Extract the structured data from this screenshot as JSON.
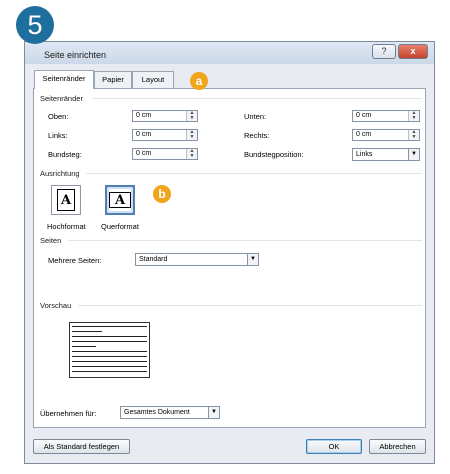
{
  "step_badge": "5",
  "dialog": {
    "title": "Seite einrichten",
    "help_button": "?",
    "close_button": "x"
  },
  "tabs": [
    {
      "label": "Seitenränder"
    },
    {
      "label": "Papier"
    },
    {
      "label": "Layout"
    }
  ],
  "annotations": {
    "a": "a",
    "b": "b"
  },
  "margins": {
    "section_label": "Seitenränder",
    "oben": {
      "label": "Oben:",
      "value": "0 cm"
    },
    "links": {
      "label": "Links:",
      "value": "0 cm"
    },
    "bundsteg": {
      "label": "Bundsteg:",
      "value": "0 cm"
    },
    "unten": {
      "label": "Unten:",
      "value": "0 cm"
    },
    "rechts": {
      "label": "Rechts:",
      "value": "0 cm"
    },
    "bundstegposition": {
      "label": "Bundstegposition:",
      "value": "Links"
    }
  },
  "orientation": {
    "section_label": "Ausrichtung",
    "hochformat": {
      "label": "Hochformat",
      "glyph": "A"
    },
    "querformat": {
      "label": "Querformat",
      "glyph": "A"
    },
    "selected": "Querformat"
  },
  "pages": {
    "section_label": "Seiten",
    "mehrere_label": "Mehrere Seiten:",
    "mehrere_value": "Standard"
  },
  "preview": {
    "section_label": "Vorschau"
  },
  "apply_to": {
    "label": "Übernehmen für:",
    "value": "Gesamtes Dokument"
  },
  "buttons": {
    "default": "Als Standard festlegen",
    "ok": "OK",
    "cancel": "Abbrechen"
  },
  "colors": {
    "badge": "#1e6f9d",
    "annotation": "#f0a51b",
    "selection": "#4f7eb3"
  },
  "icons": {
    "spin": "spin-updown-icon",
    "dropdown": "chevron-down-icon",
    "portrait": "portrait-page-icon",
    "landscape": "landscape-page-icon"
  }
}
